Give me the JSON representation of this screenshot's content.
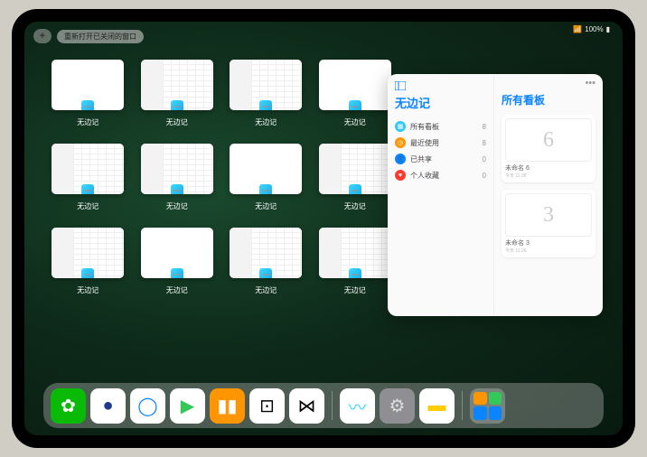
{
  "status": {
    "battery": "100%",
    "signal": "•••"
  },
  "topbar": {
    "plus_label": "+",
    "reopen_label": "重新打开已关闭的窗口"
  },
  "app_switcher": {
    "app_name": "无边记",
    "windows": [
      {
        "label": "无边记",
        "type": "blank"
      },
      {
        "label": "无边记",
        "type": "detailed"
      },
      {
        "label": "无边记",
        "type": "detailed"
      },
      {
        "label": "无边记",
        "type": "blank"
      },
      {
        "label": "无边记",
        "type": "detailed"
      },
      {
        "label": "无边记",
        "type": "detailed"
      },
      {
        "label": "无边记",
        "type": "blank"
      },
      {
        "label": "无边记",
        "type": "detailed"
      },
      {
        "label": "无边记",
        "type": "detailed"
      },
      {
        "label": "无边记",
        "type": "blank"
      },
      {
        "label": "无边记",
        "type": "detailed"
      },
      {
        "label": "无边记",
        "type": "detailed"
      }
    ]
  },
  "popover": {
    "title": "无边记",
    "categories": [
      {
        "icon": "grid",
        "label": "所有看板",
        "count": "8",
        "color": "#32c8ef"
      },
      {
        "icon": "clock",
        "label": "最近使用",
        "count": "8",
        "color": "#ff9500"
      },
      {
        "icon": "person",
        "label": "已共享",
        "count": "0",
        "color": "#0a84ff"
      },
      {
        "icon": "heart",
        "label": "个人收藏",
        "count": "0",
        "color": "#ff3b30"
      }
    ],
    "right_title": "所有看板",
    "ellipsis": "•••",
    "boards": [
      {
        "glyph": "6",
        "label": "未命名 6",
        "sub": "今天 11:28"
      },
      {
        "glyph": "3",
        "label": "未命名 3",
        "sub": "今天 11:26"
      }
    ]
  },
  "dock": {
    "apps": [
      {
        "name": "wechat",
        "bg": "#09bb07",
        "glyph": "✿",
        "fg": "#fff"
      },
      {
        "name": "browser1",
        "bg": "#ffffff",
        "glyph": "●",
        "fg": "#1e3a8a"
      },
      {
        "name": "browser2",
        "bg": "#ffffff",
        "glyph": "◯",
        "fg": "#0a84ff"
      },
      {
        "name": "play",
        "bg": "#ffffff",
        "glyph": "▶",
        "fg": "#34c759"
      },
      {
        "name": "books",
        "bg": "#ff9500",
        "glyph": "▮▮",
        "fg": "#fff"
      },
      {
        "name": "dice",
        "bg": "#ffffff",
        "glyph": "⊡",
        "fg": "#000"
      },
      {
        "name": "connect",
        "bg": "#ffffff",
        "glyph": "⋈",
        "fg": "#000"
      }
    ],
    "recents": [
      {
        "name": "freeform",
        "bg": "#ffffff",
        "glyph": "〰",
        "fg": "#3dd9ff"
      },
      {
        "name": "settings",
        "bg": "#8e8e93",
        "glyph": "⚙",
        "fg": "#ddd"
      },
      {
        "name": "notes",
        "bg": "#ffffff",
        "glyph": "▬",
        "fg": "#ffcc00"
      }
    ],
    "folder_colors": [
      "#ff9500",
      "#34c759",
      "#0a84ff",
      "#0a84ff"
    ]
  }
}
